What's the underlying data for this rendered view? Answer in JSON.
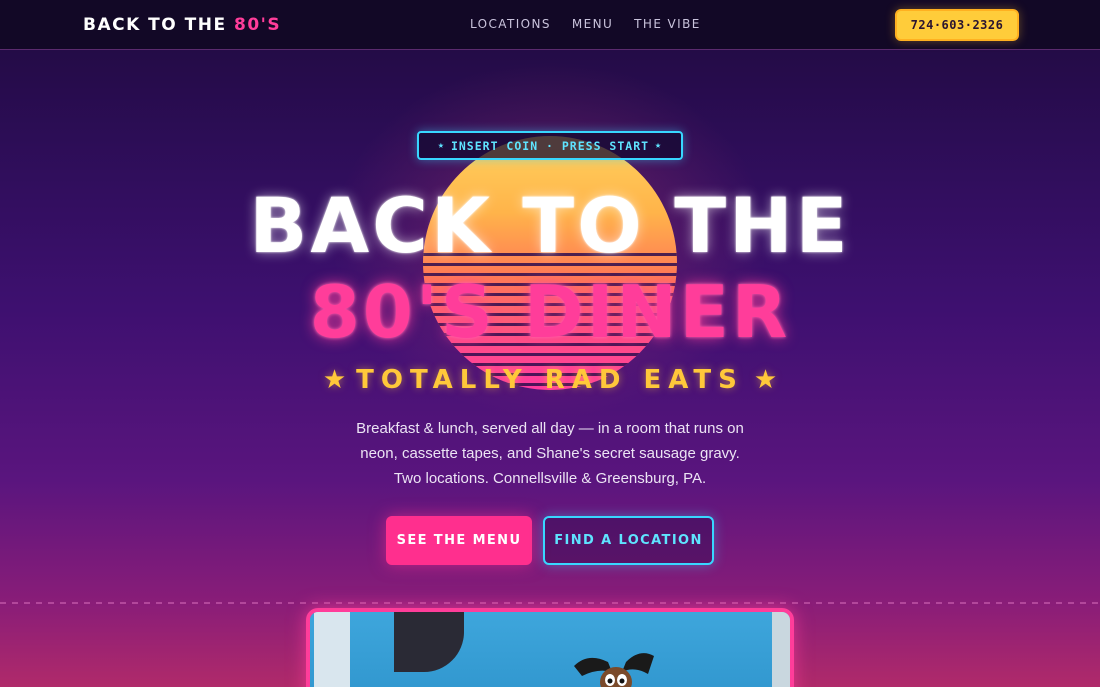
{
  "nav": {
    "brand_main": "BACK TO THE ",
    "brand_accent": "80'S",
    "links": [
      "LOCATIONS",
      "MENU",
      "THE VIBE"
    ],
    "phone": "724·603·2326"
  },
  "hero": {
    "badge_star_left": "★",
    "badge_text": "INSERT COIN · PRESS START",
    "badge_star_right": "★",
    "title_line1": "BACK TO THE",
    "title_line2": "80'S DINER",
    "tagline_star": "★",
    "tagline": "TOTALLY RAD EATS",
    "description": [
      "Breakfast & lunch, served all day — in a room that runs on",
      "neon, cassette tapes, and Shane's secret sausage gravy.",
      "Two locations. Connellsville & Greensburg, PA."
    ],
    "primary_button": "SEE THE MENU",
    "secondary_button": "FIND A LOCATION"
  },
  "colors": {
    "accent_pink": "#ff3d9a",
    "accent_cyan": "#38d7ff",
    "accent_yellow": "#ffc83a",
    "nav_bg": "#120826"
  },
  "icons": {
    "badge_star": "star-icon",
    "tagline_star": "star-icon"
  }
}
